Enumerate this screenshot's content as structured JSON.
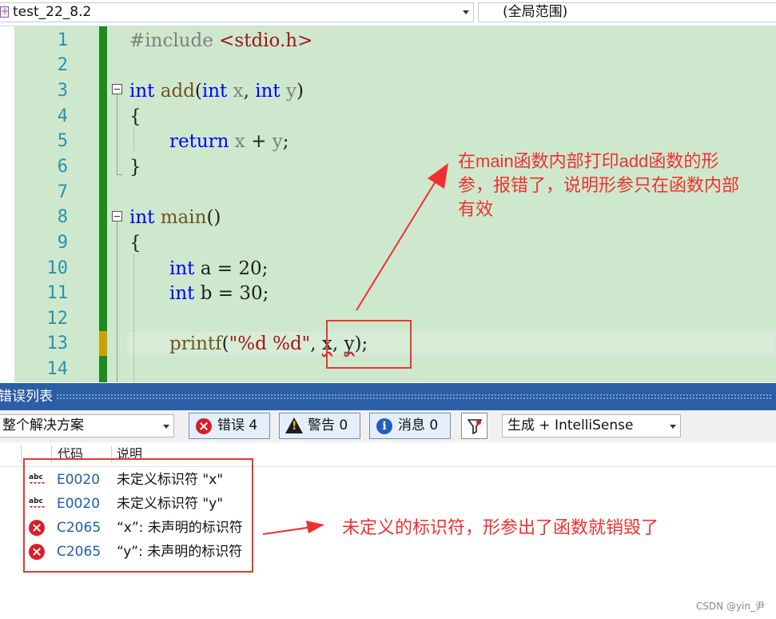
{
  "topbar": {
    "file_name": "test_22_8.2",
    "scope": "(全局范围)"
  },
  "editor": {
    "line_numbers": [
      "1",
      "2",
      "3",
      "4",
      "5",
      "6",
      "7",
      "8",
      "9",
      "10",
      "11",
      "12",
      "13",
      "14"
    ],
    "lines": {
      "l1_pp": "#include",
      "l1_inc": "<stdio.h>",
      "l3_kw1": "int",
      "l3_fn": "add",
      "l3_p1": "(",
      "l3_kw2": "int",
      "l3_x": "x",
      "l3_comma": ", ",
      "l3_kw3": "int",
      "l3_y": "y",
      "l3_p2": ")",
      "l4": "{",
      "l5_kw": "return",
      "l5_rest_x": "x",
      "l5_plus": " + ",
      "l5_rest_y": "y",
      "l5_end": ";",
      "l6": "}",
      "l8_kw": "int",
      "l8_fn": "main",
      "l8_paren": "()",
      "l9": "{",
      "l10_kw": "int",
      "l10_rest": "a = 20;",
      "l11_kw": "int",
      "l11_rest": "b = 30;",
      "l13_fn": "printf",
      "l13_open": "(",
      "l13_str": "\"%d %d\"",
      "l13_comma1": ", ",
      "l13_x": "x",
      "l13_comma2": ", ",
      "l13_y": "y",
      "l13_end": ");"
    }
  },
  "annotations": {
    "top_note": [
      "在main函数内部打印add函数的形",
      "参，报错了，说明形参只在函数内部",
      "有效"
    ],
    "bottom_note": "未定义的标识符，形参出了函数就销毁了"
  },
  "error_list": {
    "title": "错误列表",
    "scope_filter": "整个解决方案",
    "errors_btn": "错误 4",
    "warnings_btn": "警告 0",
    "messages_btn": "消息 0",
    "build_filter": "生成 + IntelliSense",
    "columns": {
      "code": "代码",
      "description": "说明"
    },
    "rows": [
      {
        "icon": "spell-check-icon",
        "code": "E0020",
        "description": "未定义标识符 \"x\""
      },
      {
        "icon": "spell-check-icon",
        "code": "E0020",
        "description": "未定义标识符 \"y\""
      },
      {
        "icon": "error-icon",
        "code": "C2065",
        "description": "“x”: 未声明的标识符"
      },
      {
        "icon": "error-icon",
        "code": "C2065",
        "description": "“y”: 未声明的标识符"
      }
    ]
  },
  "watermark": "CSDN @yin_尹",
  "colors": {
    "editor_bg": "#cde8cd",
    "keyword": "#0000ff",
    "annotation_red": "#e53935",
    "panel_title": "#2c5ea6",
    "error_red": "#d71f2a"
  }
}
